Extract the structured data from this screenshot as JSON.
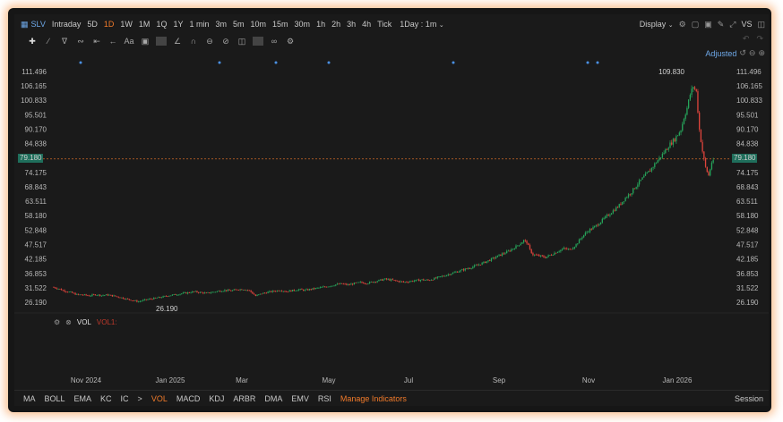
{
  "toolbar": {
    "symbol": "SLV",
    "intervals": [
      "Intraday",
      "5D",
      "1D",
      "1W",
      "1M",
      "1Q",
      "1Y",
      "1 min",
      "3m",
      "5m",
      "10m",
      "15m",
      "30m",
      "1h",
      "2h",
      "3h",
      "4h",
      "Tick"
    ],
    "active_interval": "1D",
    "period_select": "1Day : 1m",
    "display_label": "Display",
    "vs_label": "VS"
  },
  "adjusted_label": "Adjusted",
  "indicator_pane": {
    "vol_label": "VOL",
    "vol1_label": "VOL1:"
  },
  "bottom_bar": {
    "indicators": [
      "MA",
      "BOLL",
      "EMA",
      "KC",
      "IC",
      ">",
      "VOL",
      "MACD",
      "KDJ",
      "ARBR",
      "DMA",
      "EMV",
      "RSI"
    ],
    "active": "VOL",
    "manage": "Manage Indicators",
    "session": "Session"
  },
  "colors": {
    "up": "#26a65b",
    "down": "#e0443c",
    "accent": "#f07a2a",
    "current_price_box": "#1f6e5b",
    "dot_markers": "#4a90e2"
  },
  "chart_data": {
    "type": "candlestick",
    "y_ticks": [
      "111.496",
      "106.165",
      "100.833",
      "95.501",
      "90.170",
      "84.838",
      "79.180",
      "74.175",
      "68.843",
      "63.511",
      "58.180",
      "52.848",
      "47.517",
      "42.185",
      "36.853",
      "31.522",
      "26.190"
    ],
    "x_ticks": [
      "Nov 2024",
      "Jan 2025",
      "Mar",
      "May",
      "Jul",
      "Sep",
      "Nov",
      "Jan 2026"
    ],
    "current_price_label": "79.180",
    "high_label": "109.830",
    "low_label": "26.190",
    "series": [
      [
        0,
        31.8
      ],
      [
        4,
        31.2
      ],
      [
        8,
        30.4
      ],
      [
        12,
        29.8
      ],
      [
        16,
        29.0
      ],
      [
        20,
        28.9
      ],
      [
        24,
        28.6
      ],
      [
        28,
        29.0
      ],
      [
        32,
        28.7
      ],
      [
        36,
        28.9
      ],
      [
        40,
        28.5
      ],
      [
        44,
        28.0
      ],
      [
        48,
        27.4
      ],
      [
        52,
        26.9
      ],
      [
        56,
        26.4
      ],
      [
        60,
        27.0
      ],
      [
        64,
        27.4
      ],
      [
        68,
        27.8
      ],
      [
        72,
        28.2
      ],
      [
        76,
        28.7
      ],
      [
        80,
        29.0
      ],
      [
        84,
        29.4
      ],
      [
        88,
        29.7
      ],
      [
        92,
        30.1
      ],
      [
        96,
        29.8
      ],
      [
        100,
        29.5
      ],
      [
        104,
        29.9
      ],
      [
        108,
        30.3
      ],
      [
        112,
        30.6
      ],
      [
        116,
        30.4
      ],
      [
        120,
        30.9
      ],
      [
        124,
        31.0
      ],
      [
        128,
        30.5
      ],
      [
        132,
        28.5
      ],
      [
        136,
        29.4
      ],
      [
        140,
        29.9
      ],
      [
        144,
        30.3
      ],
      [
        148,
        30.6
      ],
      [
        152,
        30.2
      ],
      [
        156,
        30.5
      ],
      [
        160,
        30.9
      ],
      [
        164,
        30.6
      ],
      [
        168,
        31.0
      ],
      [
        172,
        31.4
      ],
      [
        176,
        31.8
      ],
      [
        180,
        32.2
      ],
      [
        184,
        32.7
      ],
      [
        188,
        33.0
      ],
      [
        192,
        32.6
      ],
      [
        196,
        33.1
      ],
      [
        200,
        33.5
      ],
      [
        204,
        33.2
      ],
      [
        208,
        33.7
      ],
      [
        212,
        34.2
      ],
      [
        216,
        34.7
      ],
      [
        220,
        34.4
      ],
      [
        224,
        34.0
      ],
      [
        228,
        33.6
      ],
      [
        232,
        33.9
      ],
      [
        236,
        34.2
      ],
      [
        240,
        34.5
      ],
      [
        244,
        34.3
      ],
      [
        248,
        34.9
      ],
      [
        252,
        35.6
      ],
      [
        256,
        36.3
      ],
      [
        260,
        37.0
      ],
      [
        264,
        37.7
      ],
      [
        268,
        38.4
      ],
      [
        272,
        39.1
      ],
      [
        276,
        39.9
      ],
      [
        280,
        40.8
      ],
      [
        284,
        41.8
      ],
      [
        288,
        42.9
      ],
      [
        292,
        44.0
      ],
      [
        296,
        45.0
      ],
      [
        300,
        46.4
      ],
      [
        304,
        48.0
      ],
      [
        306,
        49.0
      ],
      [
        308,
        48.3
      ],
      [
        310,
        45.5
      ],
      [
        312,
        43.8
      ],
      [
        316,
        43.3
      ],
      [
        320,
        42.8
      ],
      [
        324,
        43.8
      ],
      [
        328,
        45.0
      ],
      [
        332,
        46.0
      ],
      [
        336,
        45.6
      ],
      [
        340,
        47.5
      ],
      [
        344,
        50.5
      ],
      [
        348,
        52.7
      ],
      [
        352,
        54.0
      ],
      [
        356,
        56.0
      ],
      [
        360,
        58.0
      ],
      [
        364,
        60.0
      ],
      [
        368,
        62.0
      ],
      [
        372,
        64.8
      ],
      [
        376,
        67.0
      ],
      [
        380,
        70.0
      ],
      [
        384,
        72.5
      ],
      [
        388,
        75.0
      ],
      [
        392,
        78.0
      ],
      [
        396,
        80.8
      ],
      [
        400,
        84.0
      ],
      [
        404,
        86.5
      ],
      [
        408,
        90.0
      ],
      [
        410,
        94.5
      ],
      [
        412,
        98.0
      ],
      [
        414,
        103.0
      ],
      [
        416,
        106.0
      ],
      [
        418,
        104.0
      ],
      [
        420,
        90.0
      ],
      [
        422,
        82.0
      ],
      [
        424,
        76.0
      ],
      [
        426,
        73.0
      ],
      [
        428,
        78.0
      ]
    ]
  }
}
